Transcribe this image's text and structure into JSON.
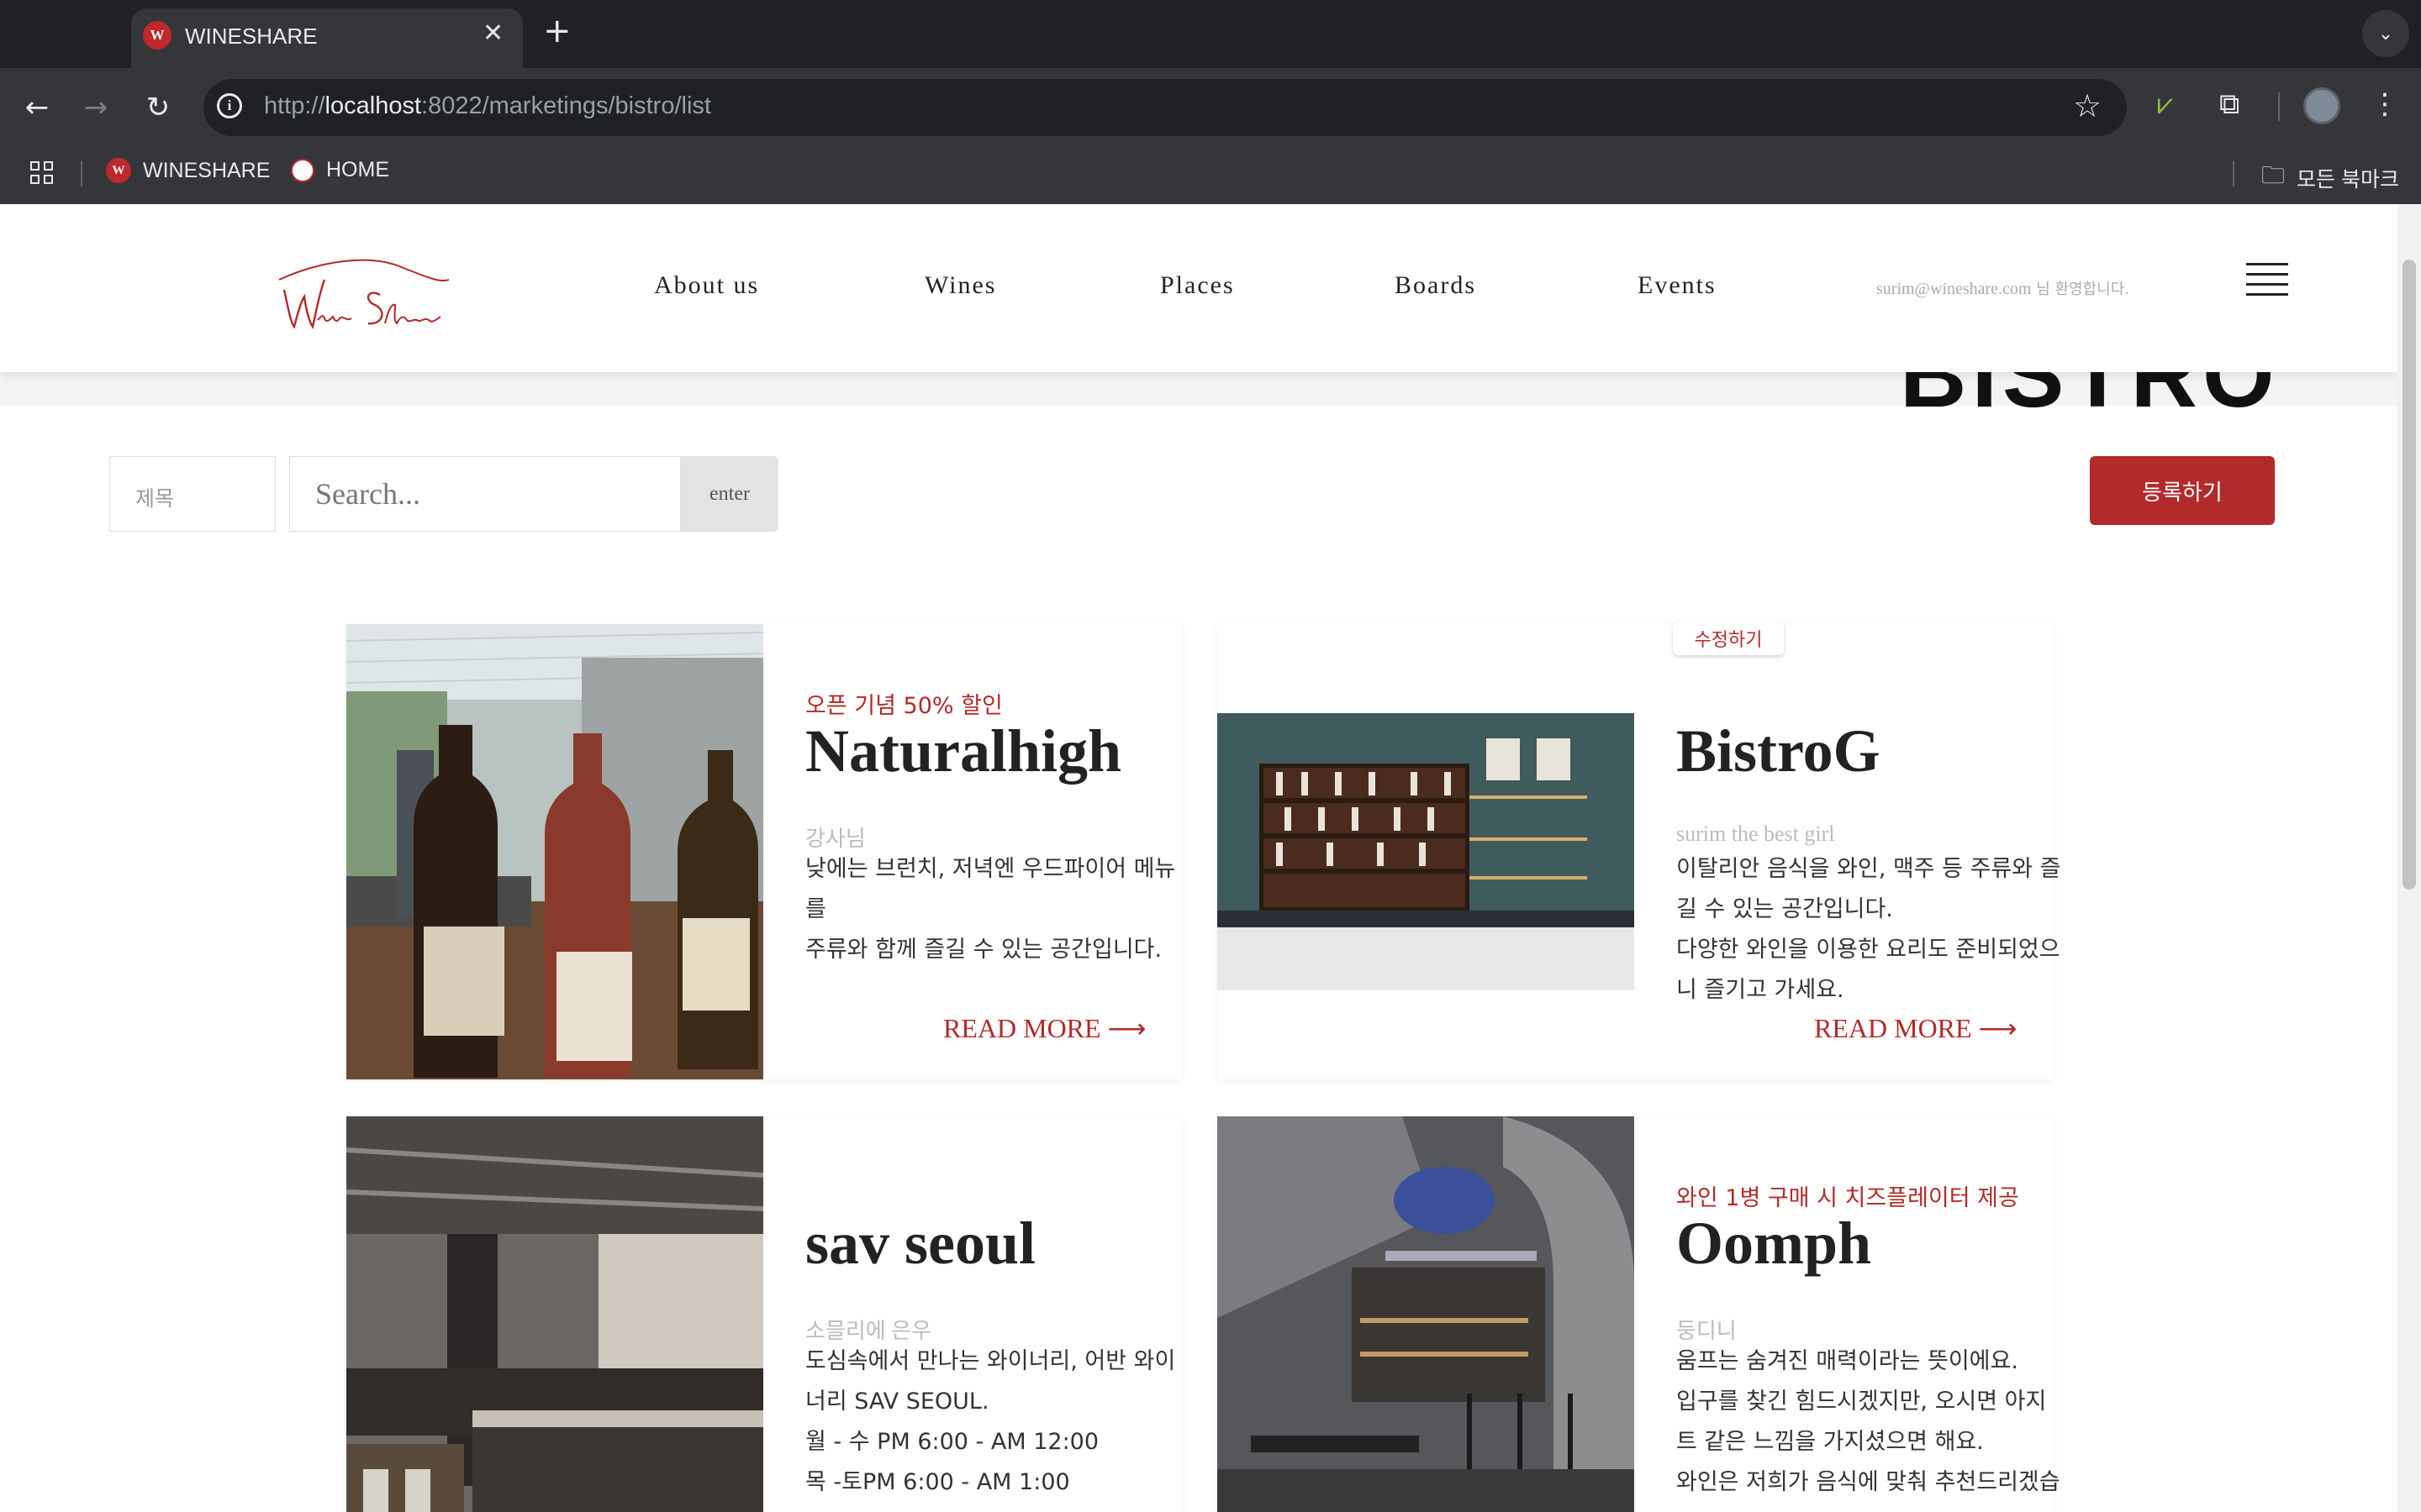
{
  "browser": {
    "tab_title": "WINESHARE",
    "tab_favicon": "W",
    "url_prefix": "http://",
    "url_host": "localhost",
    "url_path": ":8022/marketings/bistro/list",
    "bookmarks": [
      {
        "label": "WINESHARE"
      },
      {
        "label": "HOME"
      }
    ],
    "all_bookmarks_label": "모든 북마크"
  },
  "site": {
    "nav": [
      "About us",
      "Wines",
      "Places",
      "Boards",
      "Events"
    ],
    "user_email": "surim@wineshare.com",
    "welcome_suffix": " 님 환영합니다.",
    "hero_text": "BISTRO"
  },
  "search": {
    "category": "제목",
    "placeholder": "Search...",
    "enter_label": "enter",
    "register_label": "등록하기"
  },
  "cards": [
    {
      "promo": "오픈 기념 50% 할인",
      "title": "Naturalhigh",
      "author": "강사님",
      "desc": [
        "낮에는 브런치, 저녁엔 우드파이어 메뉴",
        "를",
        "주류와 함께 즐길 수 있는 공간입니다."
      ],
      "read_more": "READ MORE ⟶"
    },
    {
      "promo": "",
      "title": "BistroG",
      "author": "surim the best girl",
      "desc": [
        "이탈리안 음식을 와인, 맥주 등 주류와 즐",
        "길 수 있는 공간입니다.",
        "다양한 와인을 이용한 요리도 준비되었으",
        "니 즐기고 가세요."
      ],
      "read_more": "READ MORE ⟶",
      "edit_label": "수정하기"
    },
    {
      "promo": "",
      "title": "sav seoul",
      "author": "소믈리에 은우",
      "desc": [
        "도심속에서 만나는 와이너리, 어반 와이",
        "너리 SAV SEOUL.",
        "월 - 수 PM 6:00 - AM 12:00",
        "목 -토PM 6:00 - AM 1:00"
      ]
    },
    {
      "promo": "와인 1병 구매 시 치즈플레이터 제공",
      "title": "Oomph",
      "author": "둥디니",
      "desc": [
        "움프는 숨겨진 매력이라는 뜻이에요.",
        "입구를 찾긴 힘드시겠지만, 오시면 아지",
        "트 같은 느낌을 가지셨으면 해요.",
        "와인은 저희가 음식에 맞춰 추천드리겠습"
      ]
    }
  ],
  "colors": {
    "brand_red": "#b22a2a",
    "chrome_dark": "#202124",
    "chrome_toolbar": "#35363a"
  }
}
